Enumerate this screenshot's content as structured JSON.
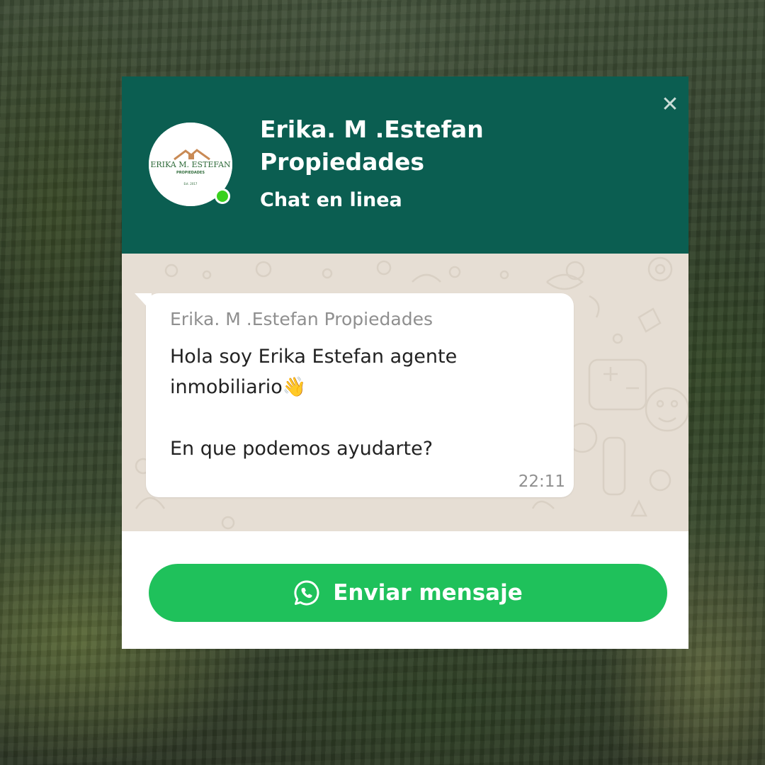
{
  "header": {
    "title": "Erika. M .Estefan Propiedades",
    "status": "Chat en linea",
    "close_symbol": "✕",
    "avatar_logo": {
      "name": "ERIKA M. ESTEFAN",
      "tagline": "PROPIEDADES",
      "est": "Est. 2017"
    },
    "colors": {
      "header_bg": "#0b5e51",
      "online": "#3ad11f"
    }
  },
  "message": {
    "sender": "Erika. M .Estefan Propiedades",
    "line1": "Hola soy Erika Estefan agente",
    "line2": "inmobiliario",
    "emoji": "👋",
    "line3": "En que podemos ayudarte?",
    "time": "22:11"
  },
  "footer": {
    "button_label": "Enviar mensaje",
    "icon": "whatsapp-icon",
    "colors": {
      "button_bg": "#1fc15b"
    }
  }
}
